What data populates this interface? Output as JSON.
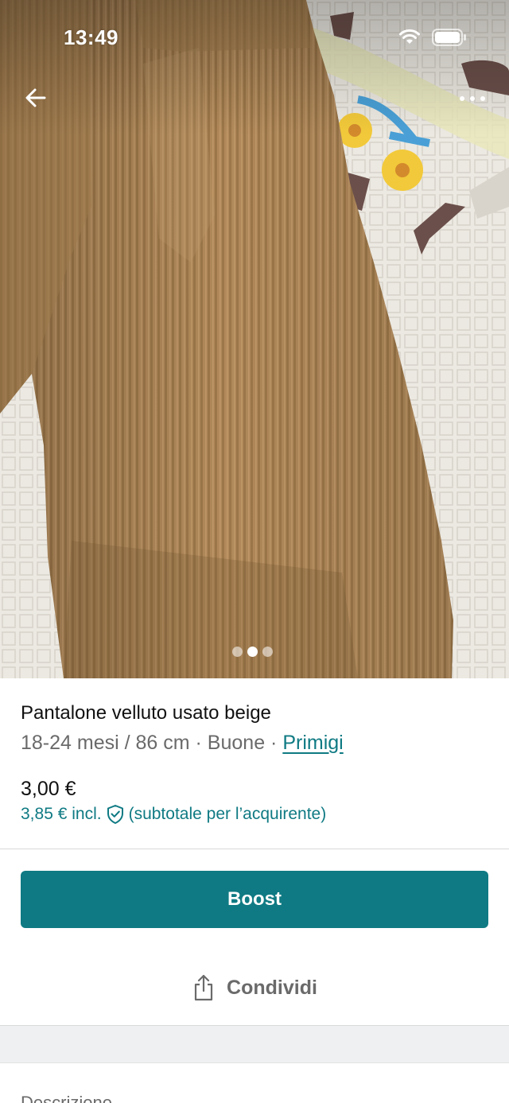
{
  "status_bar": {
    "time": "13:49"
  },
  "photo": {
    "carousel_count": 3,
    "carousel_active": 2
  },
  "item": {
    "title": "Pantalone velluto usato beige",
    "meta_prefix": "18-24 mesi / 86 cm · Buone · ",
    "brand": "Primigi",
    "price": "3,00 €",
    "price_incl_amount": "3,85 € incl.",
    "price_incl_note": "(subtotale per l’acquirente)"
  },
  "actions": {
    "boost_label": "Boost",
    "share_label": "Condividi"
  },
  "description": {
    "heading": "Descrizione"
  },
  "colors": {
    "accent": "#0f7a83",
    "text_primary": "#111111",
    "text_secondary": "#6a6a6a",
    "band": "#eef0f1"
  },
  "icons": {
    "back": "arrow-left-icon",
    "more": "more-horizontal-icon",
    "shield": "shield-check-icon",
    "share": "share-icon",
    "wifi": "wifi-icon",
    "battery": "battery-icon"
  }
}
